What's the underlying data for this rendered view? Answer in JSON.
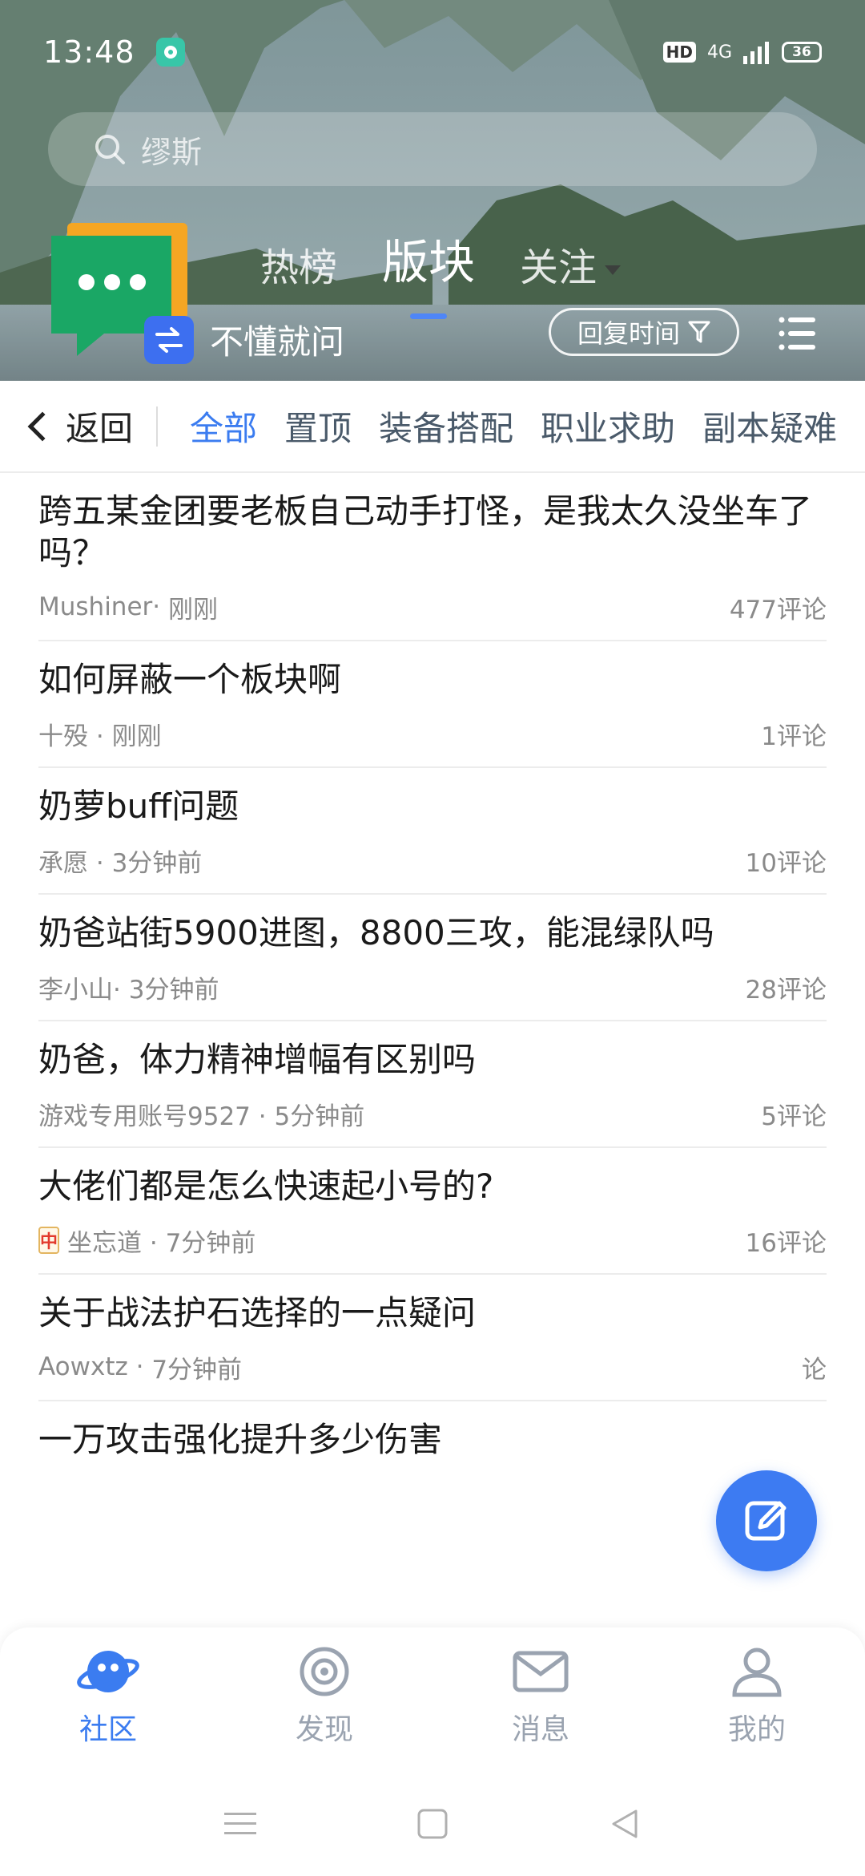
{
  "status_bar": {
    "time": "13:48",
    "hd": "HD",
    "network": "4G",
    "battery": "36"
  },
  "search": {
    "placeholder": "缪斯"
  },
  "board": {
    "name": "不懂就问"
  },
  "top_tabs": [
    {
      "label": "热榜"
    },
    {
      "label": "版块"
    },
    {
      "label": "关注"
    }
  ],
  "sort": {
    "label": "回复时间"
  },
  "back": {
    "label": "返回"
  },
  "categories": [
    {
      "label": "全部"
    },
    {
      "label": "置顶"
    },
    {
      "label": "装备搭配"
    },
    {
      "label": "职业求助"
    },
    {
      "label": "副本疑难"
    }
  ],
  "posts": [
    {
      "title": "跨五某金团要老板自己动手打怪，是我太久没坐车了吗？",
      "author": "Mushiner·",
      "time": "刚刚",
      "comments": "477评论"
    },
    {
      "title": "如何屏蔽一个板块啊",
      "author": "十殁 ·",
      "time": "刚刚",
      "comments": "1评论"
    },
    {
      "title": "奶萝buff问题",
      "author": "承愿 ·",
      "time": "3分钟前",
      "comments": "10评论"
    },
    {
      "title": "奶爸站街5900进图，8800三攻，能混绿队吗",
      "author": "李小山·",
      "time": "3分钟前",
      "comments": "28评论"
    },
    {
      "title": "奶爸，体力精神增幅有区别吗",
      "author": "游戏专用账号9527 ·",
      "time": "5分钟前",
      "comments": "5评论"
    },
    {
      "title": "大佬们都是怎么快速起小号的?",
      "author": "坐忘道  ·",
      "time": "7分钟前",
      "comments": "16评论",
      "badge": "中"
    },
    {
      "title": "关于战法护石选择的一点疑问",
      "author": "Aowxtz ·",
      "time": "7分钟前",
      "comments": "论"
    },
    {
      "title": "一万攻击强化提升多少伤害",
      "author": "",
      "time": "",
      "comments": ""
    }
  ],
  "bottom_nav": [
    {
      "label": "社区"
    },
    {
      "label": "发现"
    },
    {
      "label": "消息"
    },
    {
      "label": "我的"
    }
  ],
  "colors": {
    "accent": "#3b7cf0",
    "board_logo_green": "#1aa765",
    "board_logo_orange": "#f5a623"
  }
}
